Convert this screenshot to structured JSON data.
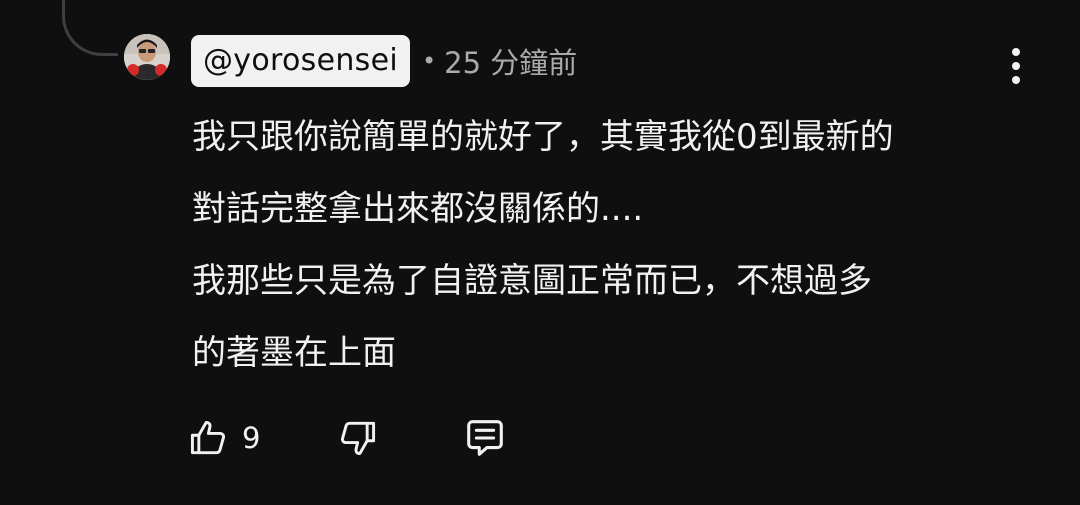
{
  "comment": {
    "author": "@yorosensei",
    "separator": "•",
    "timestamp": "25 分鐘前",
    "lines": [
      "我只跟你說簡單的就好了，其實我從0到最新的",
      "對話完整拿出來都沒關係的....",
      "我那些只是為了自證意圖正常而已，不想過多",
      "的著墨在上面"
    ],
    "likes": "9"
  },
  "icons": {
    "menu": "more-vertical-icon",
    "like": "thumbs-up-icon",
    "dislike": "thumbs-down-icon",
    "reply": "reply-comment-icon"
  },
  "colors": {
    "background": "#0f0f0f",
    "text": "#f1f1f1",
    "secondary_text": "#aaaaaa",
    "author_chip": "#f1f1f1"
  }
}
